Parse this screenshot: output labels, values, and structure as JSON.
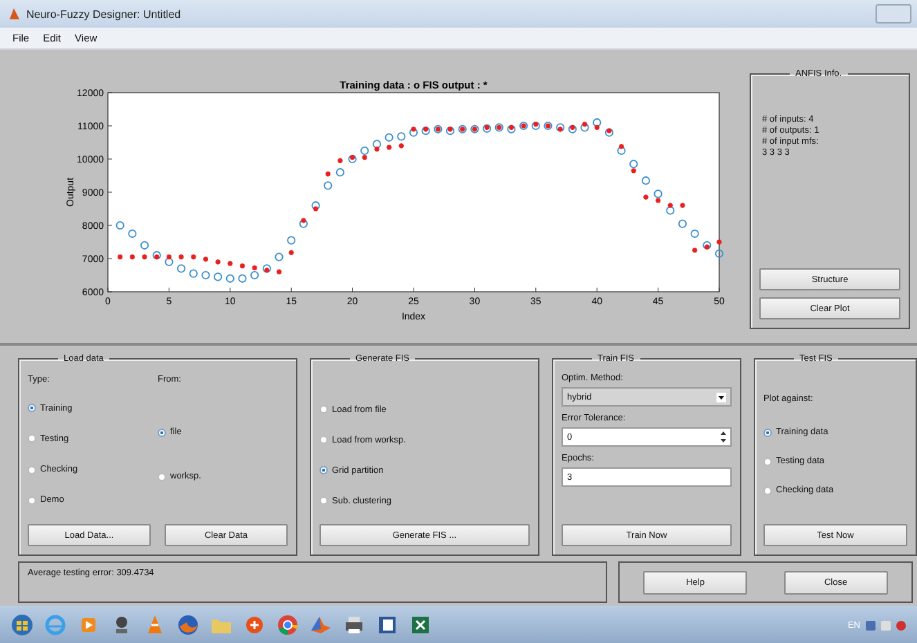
{
  "window": {
    "title": "Neuro-Fuzzy Designer: Untitled"
  },
  "menu": [
    "File",
    "Edit",
    "View"
  ],
  "plot": {
    "chart_data": {
      "type": "scatter",
      "title": "Training data : o   FIS output : *",
      "xlabel": "Index",
      "ylabel": "Output",
      "x": [
        1,
        2,
        3,
        4,
        5,
        6,
        7,
        8,
        9,
        10,
        11,
        12,
        13,
        14,
        15,
        16,
        17,
        18,
        19,
        20,
        21,
        22,
        23,
        24,
        25,
        26,
        27,
        28,
        29,
        30,
        31,
        32,
        33,
        34,
        35,
        36,
        37,
        38,
        39,
        40,
        41,
        42,
        43,
        44,
        45,
        46,
        47,
        48,
        49,
        50
      ],
      "series": [
        {
          "color": "#3b8fd0",
          "values": [
            8000,
            7750,
            7400,
            7100,
            6900,
            6700,
            6550,
            6500,
            6450,
            6400,
            6400,
            6500,
            6700,
            7050,
            7550,
            8050,
            8600,
            9200,
            9600,
            10000,
            10250,
            10450,
            10650,
            10680,
            10800,
            10850,
            10900,
            10850,
            10900,
            10900,
            10920,
            10950,
            10900,
            11000,
            11000,
            11000,
            10950,
            10900,
            10950,
            11100,
            10800,
            10250,
            9850,
            9350,
            8950,
            8450,
            8050,
            7750,
            7400,
            7150
          ]
        },
        {
          "color": "#e82020",
          "values": [
            7050,
            7050,
            7050,
            7050,
            7050,
            7050,
            7050,
            6980,
            6900,
            6850,
            6780,
            6720,
            6650,
            6600,
            7180,
            8150,
            8500,
            9550,
            9950,
            10050,
            10050,
            10300,
            10350,
            10400,
            10900,
            10900,
            10900,
            10900,
            10900,
            10900,
            10950,
            10950,
            10950,
            11000,
            11050,
            11000,
            10900,
            10950,
            11050,
            10950,
            10850,
            10380,
            9650,
            8850,
            8750,
            8600,
            8600,
            7250,
            7350,
            7500
          ]
        }
      ],
      "xlim": [
        0,
        50
      ],
      "ylim": [
        6000,
        12000
      ],
      "xticks": [
        0,
        5,
        10,
        15,
        20,
        25,
        30,
        35,
        40,
        45,
        50
      ],
      "yticks": [
        6000,
        7000,
        8000,
        9000,
        10000,
        11000,
        12000
      ]
    }
  },
  "anfis_info": {
    "title": "ANFIS Info.",
    "lines": [
      "# of inputs: 4",
      "# of outputs: 1",
      "# of input mfs:",
      "3 3 3 3"
    ],
    "buttons": [
      "Structure",
      "Clear Plot"
    ]
  },
  "load_data": {
    "title": "Load data",
    "type_label": "Type:",
    "from_label": "From:",
    "types": [
      {
        "label": "Training",
        "selected": true
      },
      {
        "label": "Testing",
        "selected": false
      },
      {
        "label": "Checking",
        "selected": false
      },
      {
        "label": "Demo",
        "selected": false
      }
    ],
    "sources": [
      {
        "label": "file",
        "selected": true
      },
      {
        "label": "worksp.",
        "selected": false
      }
    ],
    "buttons": [
      "Load Data...",
      "Clear Data"
    ]
  },
  "generate_fis": {
    "title": "Generate FIS",
    "options": [
      {
        "label": "Load from file",
        "selected": false
      },
      {
        "label": "Load from worksp.",
        "selected": false
      },
      {
        "label": "Grid partition",
        "selected": true
      },
      {
        "label": "Sub. clustering",
        "selected": false
      }
    ],
    "button": "Generate FIS ..."
  },
  "train_fis": {
    "title": "Train FIS",
    "method_label": "Optim. Method:",
    "method": "hybrid",
    "tolerance_label": "Error Tolerance:",
    "tolerance": "0",
    "epochs_label": "Epochs:",
    "epochs": "3",
    "button": "Train Now"
  },
  "test_fis": {
    "title": "Test FIS",
    "plot_label": "Plot against:",
    "options": [
      {
        "label": "Training data",
        "selected": true
      },
      {
        "label": "Testing data",
        "selected": false
      },
      {
        "label": "Checking data",
        "selected": false
      }
    ],
    "button": "Test Now"
  },
  "status": "Average testing error: 309.4734",
  "buttons": [
    "Help",
    "Close"
  ],
  "taskbar": {
    "language": "EN"
  }
}
